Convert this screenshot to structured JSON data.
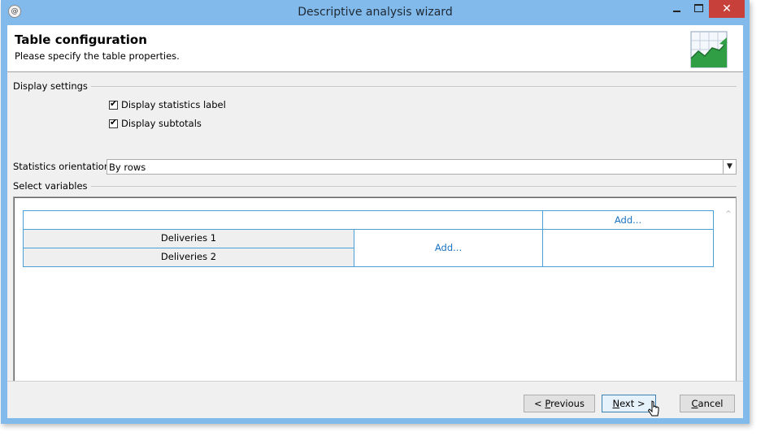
{
  "window": {
    "title": "Descriptive analysis wizard",
    "close_glyph": "✕",
    "controls": [
      "minimize-icon",
      "maximize-icon",
      "close-icon"
    ]
  },
  "header": {
    "title": "Table configuration",
    "subtitle": "Please specify the table properties."
  },
  "display_settings": {
    "group_label": "Display settings",
    "show_statistics_label": {
      "label": "Display statistics label",
      "checked": true
    },
    "show_subtotals": {
      "label": "Display subtotals",
      "checked": true
    }
  },
  "orientation": {
    "label": "Statistics orientation:",
    "value": "By rows"
  },
  "variables": {
    "group_label": "Select variables",
    "column_add": "Add...",
    "row_vars": [
      "Deliveries 1",
      "Deliveries 2"
    ],
    "row_add": "Add..."
  },
  "footer": {
    "previous": {
      "prefix": "< ",
      "mnemonic": "P",
      "rest": "revious"
    },
    "next": {
      "mnemonic": "N",
      "rest": "ext >"
    },
    "cancel": {
      "mnemonic": "C",
      "rest": "ancel"
    }
  },
  "colors": {
    "frame": "#82baec",
    "grid_border": "#4a9fd6",
    "link": "#1a73c2",
    "close_button": "#c7403a"
  }
}
